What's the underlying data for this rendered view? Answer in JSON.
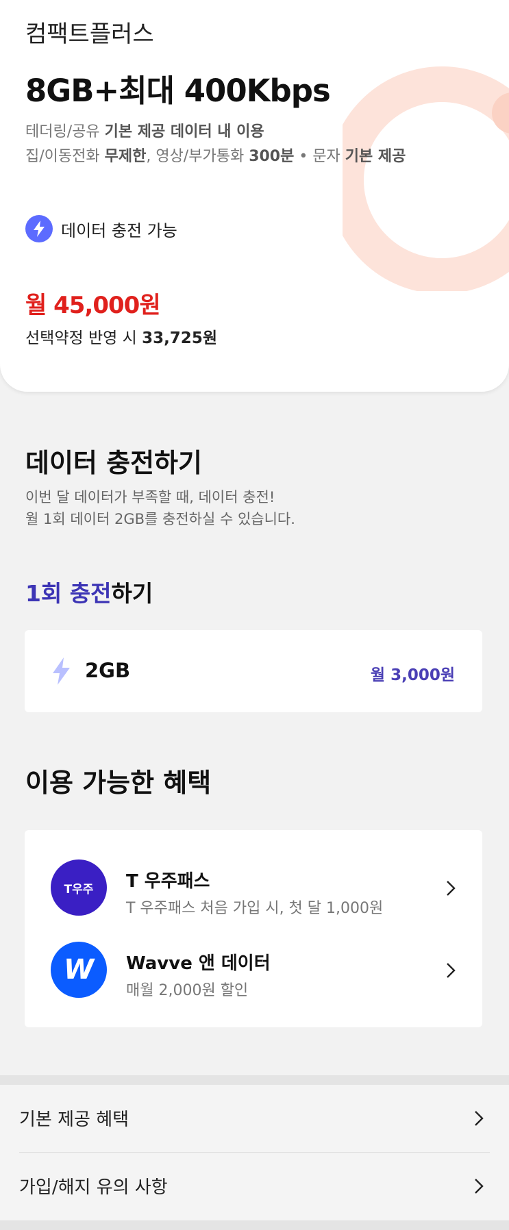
{
  "plan": {
    "name": "컴팩트플러스",
    "data": "8GB+최대 400Kbps",
    "desc1_pre": "테더링/공유 ",
    "desc1_bold": "기본 제공 데이터 내 이용",
    "desc2_a": "집/이동전화 ",
    "desc2_b": "무제한",
    "desc2_c": ", 영상/부가통화 ",
    "desc2_d": "300분",
    "desc2_e": " • 문자 ",
    "desc2_f": "기본 제공",
    "recharge_badge": "데이터 충전 가능",
    "price": "월 45,000원",
    "discount_pre": "선택약정 반영 시 ",
    "discount_price": "33,725원"
  },
  "recharge_section": {
    "title": "데이터 충전하기",
    "line1": "이번 달 데이터가 부족할 때, 데이터 충전!",
    "line2": "월 1회 데이터 2GB를 충전하실 수 있습니다.",
    "once_highlight": "1회 충전",
    "once_rest": "하기",
    "option": {
      "amount": "2GB",
      "price": "월 3,000원"
    }
  },
  "benefits": {
    "title": "이용 가능한 혜택",
    "items": [
      {
        "name": "T 우주패스",
        "sub": "T 우주패스 처음 가입 시, 첫 달 1,000원",
        "logo_text": "T우주",
        "logo_color": "#3a1fc4",
        "icon": "t-universe-logo"
      },
      {
        "name": "Wavve 앤 데이터",
        "sub": "매월 2,000원 할인",
        "logo_text": "W",
        "logo_color": "#0b5cff",
        "icon": "wavve-logo"
      }
    ]
  },
  "bottom_links": [
    {
      "label": "기본 제공 혜택"
    },
    {
      "label": "가입/해지 유의 사항"
    }
  ],
  "colors": {
    "price_red": "#e0201c",
    "accent_purple": "#3d35b5",
    "bolt_blue": "#5c6bff",
    "deco_peach": "#fde3da"
  }
}
